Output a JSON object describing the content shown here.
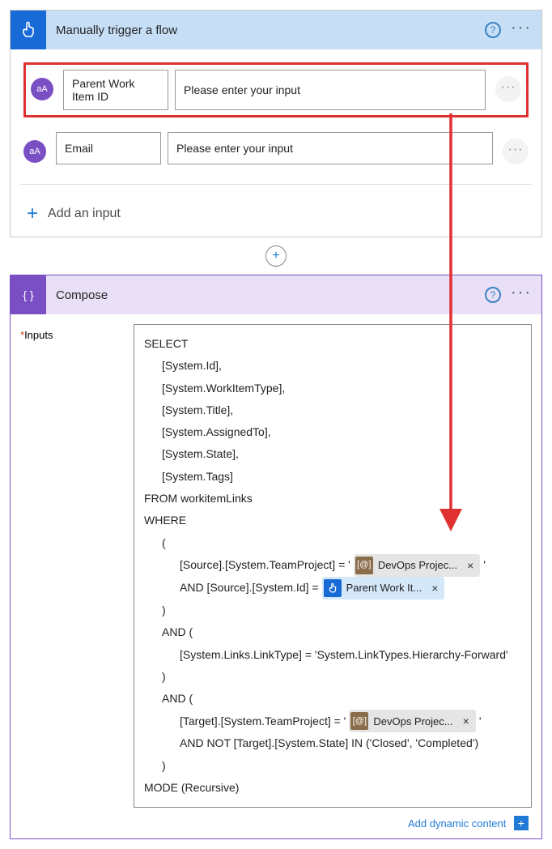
{
  "trigger": {
    "title": "Manually trigger a flow",
    "input1": {
      "label": "Parent Work Item ID",
      "placeholder": "Please enter your input"
    },
    "input2": {
      "label": "Email",
      "placeholder": "Please enter your input"
    },
    "avatar": "aA",
    "add_input": "Add an input"
  },
  "compose": {
    "title": "Compose",
    "inputs_label": "Inputs",
    "code": {
      "l0": "SELECT",
      "l1": "[System.Id],",
      "l2": "[System.WorkItemType],",
      "l3": "[System.Title],",
      "l4": "[System.AssignedTo],",
      "l5": "[System.State],",
      "l6": "[System.Tags]",
      "l7": "FROM workitemLinks",
      "l8": "WHERE",
      "l9": "(",
      "l10a": "[Source].[System.TeamProject] = '",
      "l10b": "'",
      "l11a": "AND [Source].[System.Id] = ",
      "l12": ")",
      "l13": "AND (",
      "l14": "[System.Links.LinkType] = 'System.LinkTypes.Hierarchy-Forward'",
      "l15": ")",
      "l16": "AND (",
      "l17a": "[Target].[System.TeamProject] = '",
      "l17b": "'",
      "l18": "AND NOT [Target].[System.State] IN ('Closed', 'Completed')",
      "l19": ")",
      "l20": "MODE (Recursive)"
    },
    "tokens": {
      "devops": "DevOps Projec...",
      "parent": "Parent Work It..."
    },
    "devops_icon_text": "[@]",
    "dynamic": "Add dynamic content"
  }
}
